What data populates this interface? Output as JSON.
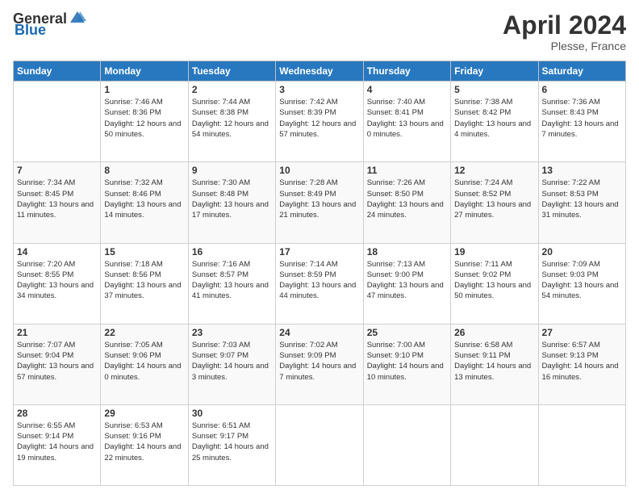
{
  "header": {
    "logo_general": "General",
    "logo_blue": "Blue",
    "title": "April 2024",
    "subtitle": "Plesse, France"
  },
  "days_of_week": [
    "Sunday",
    "Monday",
    "Tuesday",
    "Wednesday",
    "Thursday",
    "Friday",
    "Saturday"
  ],
  "weeks": [
    [
      {
        "day": "",
        "sunrise": "",
        "sunset": "",
        "daylight": ""
      },
      {
        "day": "1",
        "sunrise": "Sunrise: 7:46 AM",
        "sunset": "Sunset: 8:36 PM",
        "daylight": "Daylight: 12 hours and 50 minutes."
      },
      {
        "day": "2",
        "sunrise": "Sunrise: 7:44 AM",
        "sunset": "Sunset: 8:38 PM",
        "daylight": "Daylight: 12 hours and 54 minutes."
      },
      {
        "day": "3",
        "sunrise": "Sunrise: 7:42 AM",
        "sunset": "Sunset: 8:39 PM",
        "daylight": "Daylight: 12 hours and 57 minutes."
      },
      {
        "day": "4",
        "sunrise": "Sunrise: 7:40 AM",
        "sunset": "Sunset: 8:41 PM",
        "daylight": "Daylight: 13 hours and 0 minutes."
      },
      {
        "day": "5",
        "sunrise": "Sunrise: 7:38 AM",
        "sunset": "Sunset: 8:42 PM",
        "daylight": "Daylight: 13 hours and 4 minutes."
      },
      {
        "day": "6",
        "sunrise": "Sunrise: 7:36 AM",
        "sunset": "Sunset: 8:43 PM",
        "daylight": "Daylight: 13 hours and 7 minutes."
      }
    ],
    [
      {
        "day": "7",
        "sunrise": "Sunrise: 7:34 AM",
        "sunset": "Sunset: 8:45 PM",
        "daylight": "Daylight: 13 hours and 11 minutes."
      },
      {
        "day": "8",
        "sunrise": "Sunrise: 7:32 AM",
        "sunset": "Sunset: 8:46 PM",
        "daylight": "Daylight: 13 hours and 14 minutes."
      },
      {
        "day": "9",
        "sunrise": "Sunrise: 7:30 AM",
        "sunset": "Sunset: 8:48 PM",
        "daylight": "Daylight: 13 hours and 17 minutes."
      },
      {
        "day": "10",
        "sunrise": "Sunrise: 7:28 AM",
        "sunset": "Sunset: 8:49 PM",
        "daylight": "Daylight: 13 hours and 21 minutes."
      },
      {
        "day": "11",
        "sunrise": "Sunrise: 7:26 AM",
        "sunset": "Sunset: 8:50 PM",
        "daylight": "Daylight: 13 hours and 24 minutes."
      },
      {
        "day": "12",
        "sunrise": "Sunrise: 7:24 AM",
        "sunset": "Sunset: 8:52 PM",
        "daylight": "Daylight: 13 hours and 27 minutes."
      },
      {
        "day": "13",
        "sunrise": "Sunrise: 7:22 AM",
        "sunset": "Sunset: 8:53 PM",
        "daylight": "Daylight: 13 hours and 31 minutes."
      }
    ],
    [
      {
        "day": "14",
        "sunrise": "Sunrise: 7:20 AM",
        "sunset": "Sunset: 8:55 PM",
        "daylight": "Daylight: 13 hours and 34 minutes."
      },
      {
        "day": "15",
        "sunrise": "Sunrise: 7:18 AM",
        "sunset": "Sunset: 8:56 PM",
        "daylight": "Daylight: 13 hours and 37 minutes."
      },
      {
        "day": "16",
        "sunrise": "Sunrise: 7:16 AM",
        "sunset": "Sunset: 8:57 PM",
        "daylight": "Daylight: 13 hours and 41 minutes."
      },
      {
        "day": "17",
        "sunrise": "Sunrise: 7:14 AM",
        "sunset": "Sunset: 8:59 PM",
        "daylight": "Daylight: 13 hours and 44 minutes."
      },
      {
        "day": "18",
        "sunrise": "Sunrise: 7:13 AM",
        "sunset": "Sunset: 9:00 PM",
        "daylight": "Daylight: 13 hours and 47 minutes."
      },
      {
        "day": "19",
        "sunrise": "Sunrise: 7:11 AM",
        "sunset": "Sunset: 9:02 PM",
        "daylight": "Daylight: 13 hours and 50 minutes."
      },
      {
        "day": "20",
        "sunrise": "Sunrise: 7:09 AM",
        "sunset": "Sunset: 9:03 PM",
        "daylight": "Daylight: 13 hours and 54 minutes."
      }
    ],
    [
      {
        "day": "21",
        "sunrise": "Sunrise: 7:07 AM",
        "sunset": "Sunset: 9:04 PM",
        "daylight": "Daylight: 13 hours and 57 minutes."
      },
      {
        "day": "22",
        "sunrise": "Sunrise: 7:05 AM",
        "sunset": "Sunset: 9:06 PM",
        "daylight": "Daylight: 14 hours and 0 minutes."
      },
      {
        "day": "23",
        "sunrise": "Sunrise: 7:03 AM",
        "sunset": "Sunset: 9:07 PM",
        "daylight": "Daylight: 14 hours and 3 minutes."
      },
      {
        "day": "24",
        "sunrise": "Sunrise: 7:02 AM",
        "sunset": "Sunset: 9:09 PM",
        "daylight": "Daylight: 14 hours and 7 minutes."
      },
      {
        "day": "25",
        "sunrise": "Sunrise: 7:00 AM",
        "sunset": "Sunset: 9:10 PM",
        "daylight": "Daylight: 14 hours and 10 minutes."
      },
      {
        "day": "26",
        "sunrise": "Sunrise: 6:58 AM",
        "sunset": "Sunset: 9:11 PM",
        "daylight": "Daylight: 14 hours and 13 minutes."
      },
      {
        "day": "27",
        "sunrise": "Sunrise: 6:57 AM",
        "sunset": "Sunset: 9:13 PM",
        "daylight": "Daylight: 14 hours and 16 minutes."
      }
    ],
    [
      {
        "day": "28",
        "sunrise": "Sunrise: 6:55 AM",
        "sunset": "Sunset: 9:14 PM",
        "daylight": "Daylight: 14 hours and 19 minutes."
      },
      {
        "day": "29",
        "sunrise": "Sunrise: 6:53 AM",
        "sunset": "Sunset: 9:16 PM",
        "daylight": "Daylight: 14 hours and 22 minutes."
      },
      {
        "day": "30",
        "sunrise": "Sunrise: 6:51 AM",
        "sunset": "Sunset: 9:17 PM",
        "daylight": "Daylight: 14 hours and 25 minutes."
      },
      {
        "day": "",
        "sunrise": "",
        "sunset": "",
        "daylight": ""
      },
      {
        "day": "",
        "sunrise": "",
        "sunset": "",
        "daylight": ""
      },
      {
        "day": "",
        "sunrise": "",
        "sunset": "",
        "daylight": ""
      },
      {
        "day": "",
        "sunrise": "",
        "sunset": "",
        "daylight": ""
      }
    ]
  ]
}
